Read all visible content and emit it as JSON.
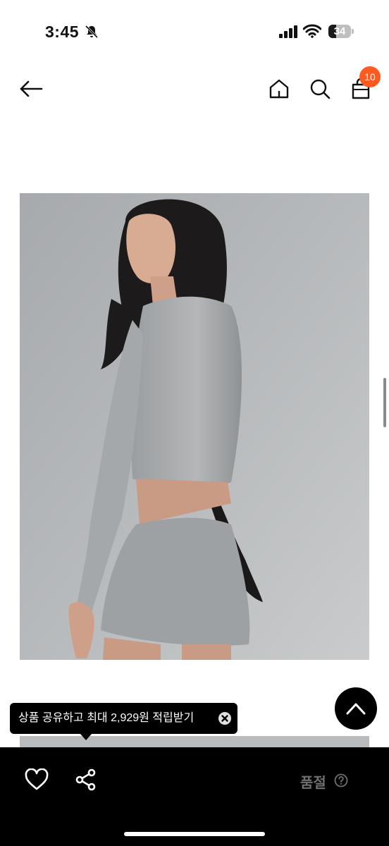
{
  "status_bar": {
    "time": "3:45",
    "battery": "34",
    "battery_level": 0.34
  },
  "header": {
    "cart_count": "10",
    "icons": [
      "back-arrow-icon",
      "home-icon",
      "search-icon",
      "shopping-bag-icon"
    ],
    "badge_color": "#ff5a1f"
  },
  "product_image": {
    "icon": "product-photo"
  },
  "tooltip": {
    "text": "상품 공유하고 최대 2,929원 적립받기"
  },
  "bottom_bar": {
    "status_label": "품절",
    "icons": [
      "heart-icon",
      "share-icon",
      "help-circle-icon"
    ]
  }
}
